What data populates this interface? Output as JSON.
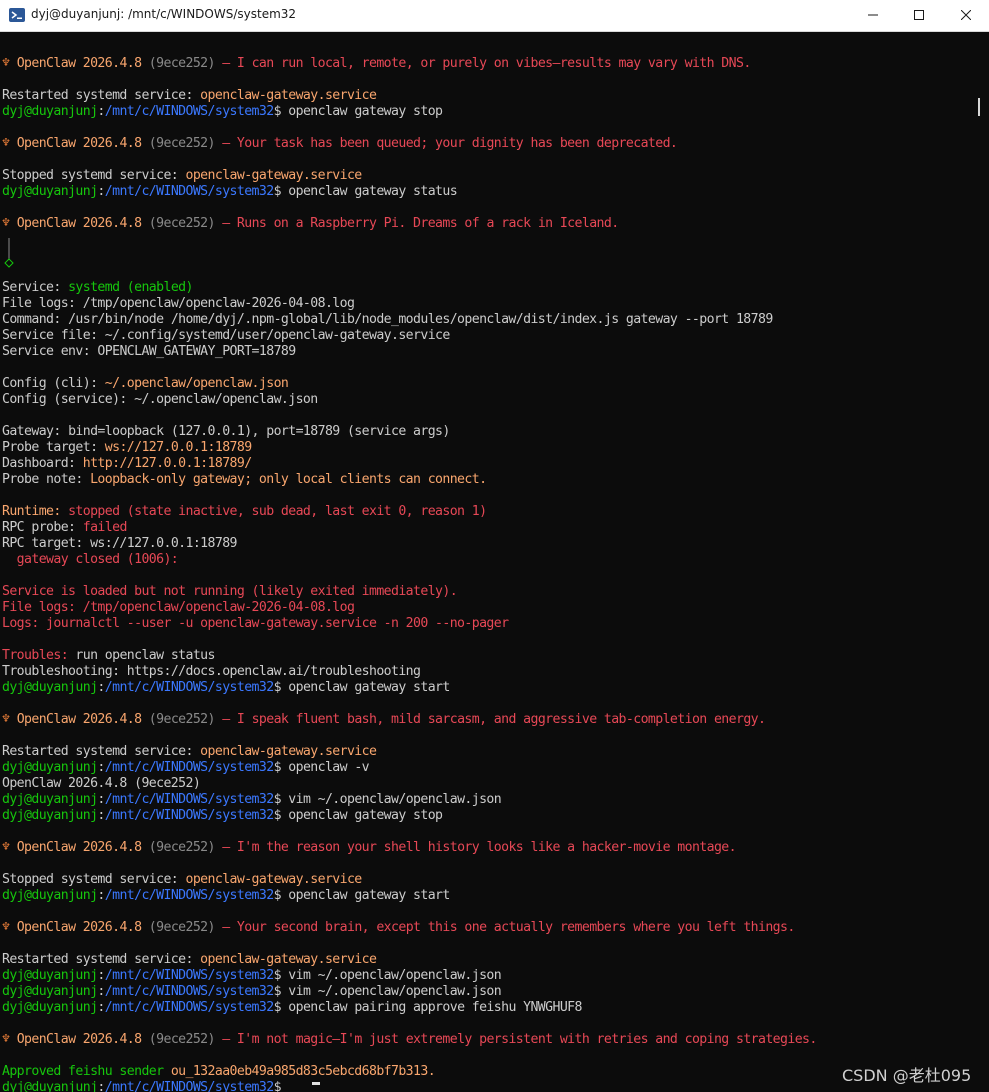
{
  "window": {
    "title": "dyj@duyanjunj: /mnt/c/WINDOWS/system32",
    "icon": "terminal-icon",
    "controls": [
      "minimize-icon",
      "maximize-icon",
      "close-icon"
    ]
  },
  "colors": {
    "background": "#0c0c0c",
    "prompt_user": "#16c60c",
    "prompt_path": "#3b78ff",
    "error": "#e74856",
    "accent": "#f9a66e"
  },
  "prompt": {
    "user": "dyj@duyanjunj",
    "path": "/mnt/c/WINDOWS/system32",
    "symbol": "$"
  },
  "terminal": {
    "lines": [
      "OpenClaw 2026.4.8 (9ece252) — I can run local, remote, or purely on vibes—results may vary with DNS.",
      "Restarted systemd service: openclaw-gateway.service",
      "openclaw gateway stop",
      "OpenClaw 2026.4.8 (9ece252) — Your task has been queued; your dignity has been deprecated.",
      "Stopped systemd service: openclaw-gateway.service",
      "openclaw gateway status",
      "OpenClaw 2026.4.8 (9ece252) — Runs on a Raspberry Pi. Dreams of a rack in Iceland.",
      "Service: systemd (enabled)",
      "File logs: /tmp/openclaw/openclaw-2026-04-08.log",
      "Command: /usr/bin/node /home/dyj/.npm-global/lib/node_modules/openclaw/dist/index.js gateway --port 18789",
      "Service file: ~/.config/systemd/user/openclaw-gateway.service",
      "Service env: OPENCLAW_GATEWAY_PORT=18789",
      "Config (cli): ~/.openclaw/openclaw.json",
      "Config (service): ~/.openclaw/openclaw.json",
      "Gateway: bind=loopback (127.0.0.1), port=18789 (service args)",
      "Probe target: ws://127.0.0.1:18789",
      "Dashboard: http://127.0.0.1:18789/",
      "Probe note: Loopback-only gateway; only local clients can connect.",
      "Runtime: stopped (state inactive, sub dead, last exit 0, reason 1)",
      "RPC probe: failed",
      "RPC target: ws://127.0.0.1:18789",
      "  gateway closed (1006):",
      "Service is loaded but not running (likely exited immediately).",
      "File logs: /tmp/openclaw/openclaw-2026-04-08.log",
      "Logs: journalctl --user -u openclaw-gateway.service -n 200 --no-pager",
      "Troubles: run openclaw status",
      "Troubleshooting: https://docs.openclaw.ai/troubleshooting",
      "openclaw gateway start",
      "OpenClaw 2026.4.8 (9ece252) — I speak fluent bash, mild sarcasm, and aggressive tab-completion energy.",
      "Restarted systemd service: openclaw-gateway.service",
      "openclaw -v",
      "OpenClaw 2026.4.8 (9ece252)",
      "vim ~/.openclaw/openclaw.json",
      "openclaw gateway stop",
      "OpenClaw 2026.4.8 (9ece252) — I'm the reason your shell history looks like a hacker-movie montage.",
      "Stopped systemd service: openclaw-gateway.service",
      "openclaw gateway start",
      "OpenClaw 2026.4.8 (9ece252) — Your second brain, except this one actually remembers where you left things.",
      "Restarted systemd service: openclaw-gateway.service",
      "vim ~/.openclaw/openclaw.json",
      "vim ~/.openclaw/openclaw.json",
      "openclaw pairing approve feishu YNWGHUF8",
      "OpenClaw 2026.4.8 (9ece252) — I'm not magic—I'm just extremely persistent with retries and coping strategies.",
      "Approved feishu sender ou_132aa0eb49a985d83c5ebcd68bf7b313."
    ]
  },
  "watermark": "CSDN @老杜095"
}
